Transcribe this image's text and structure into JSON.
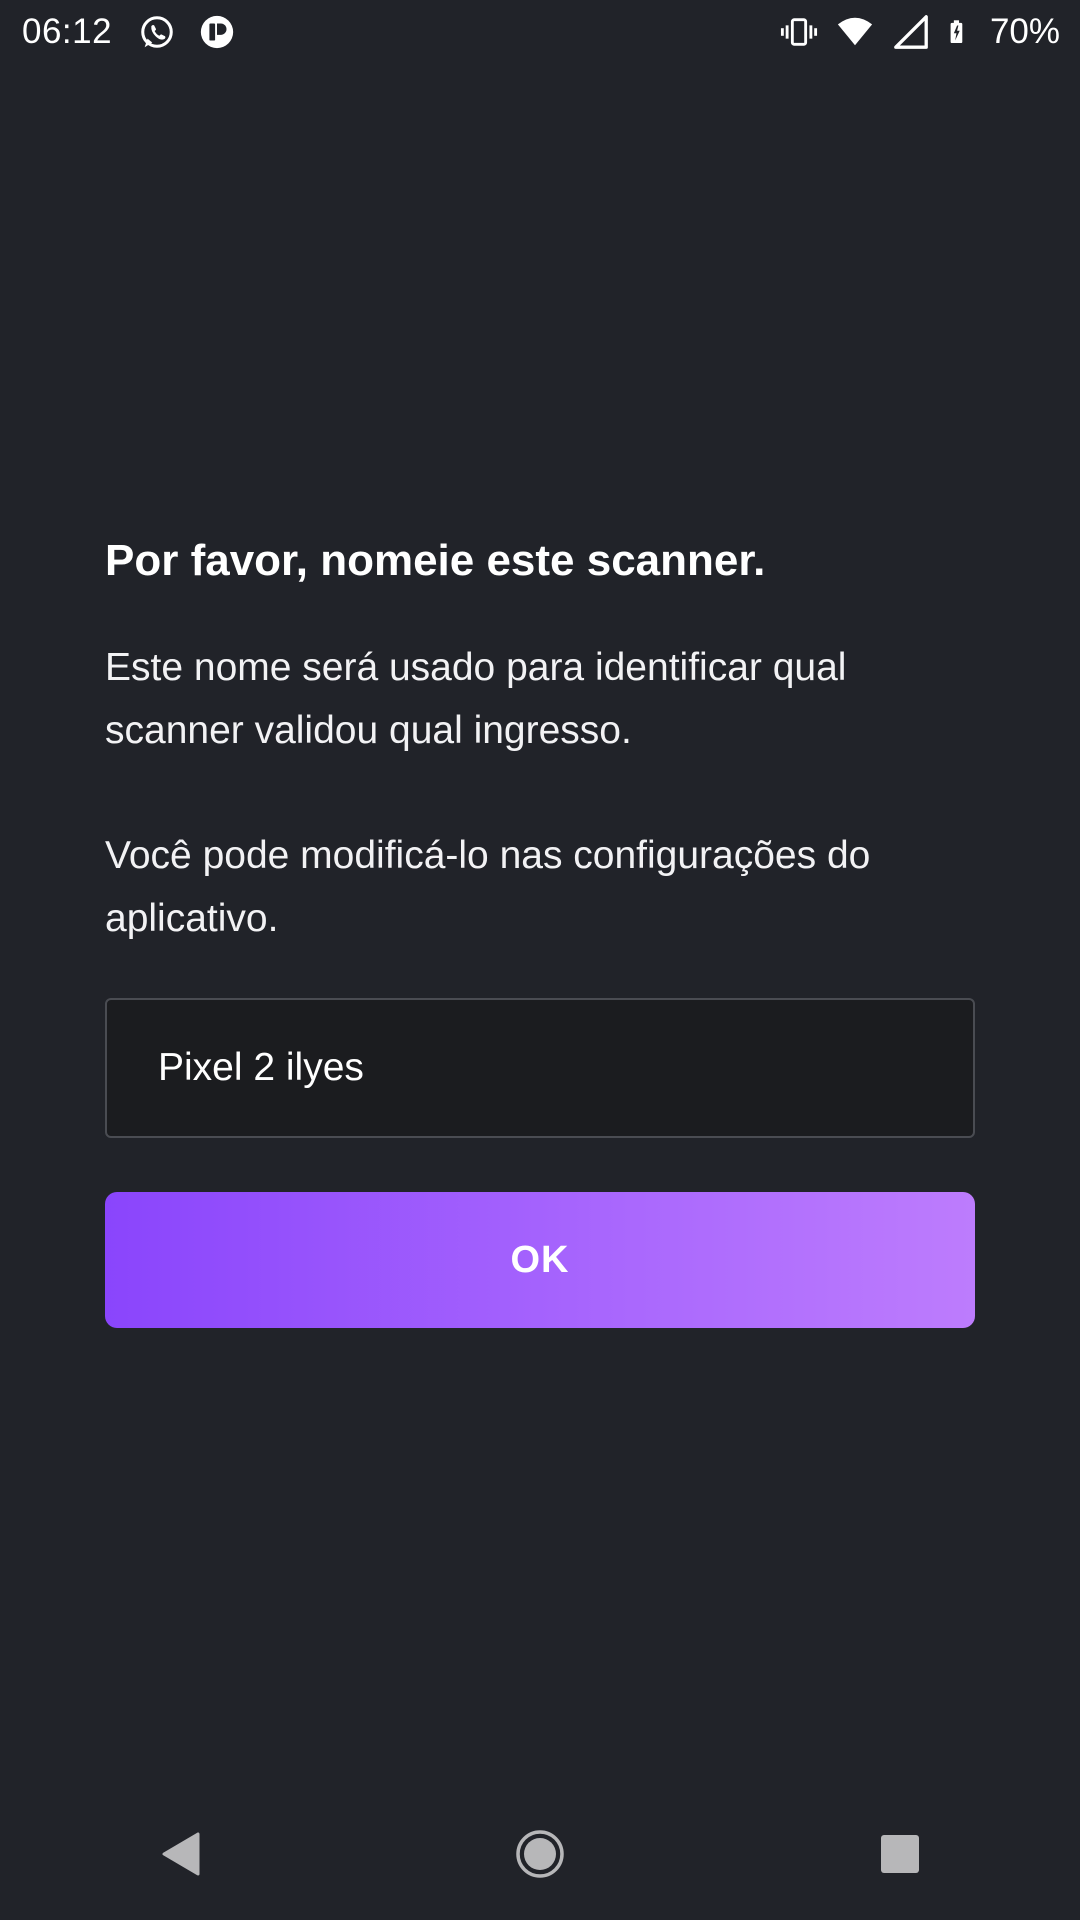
{
  "status_bar": {
    "time": "06:12",
    "battery_percent": "70%",
    "notification_icons": [
      "whatsapp-icon",
      "app-notification-icon"
    ],
    "system_icons": [
      "vibrate-icon",
      "wifi-icon",
      "cellular-signal-icon",
      "battery-charging-icon"
    ]
  },
  "dialog": {
    "title": "Por favor, nomeie este scanner.",
    "description": "Este nome será usado para identificar qual scanner validou qual ingresso.",
    "note": "Você pode modificá-lo nas configurações do aplicativo.",
    "name_input_value": "Pixel 2 ilyes",
    "ok_label": "OK"
  },
  "nav_bar": {
    "buttons": [
      "back-icon",
      "home-icon",
      "recents-icon"
    ]
  },
  "colors": {
    "background": "#212329",
    "input_background": "#1b1c1f",
    "button_gradient_start": "#8a45fc",
    "button_gradient_end": "#bd7cfd"
  }
}
